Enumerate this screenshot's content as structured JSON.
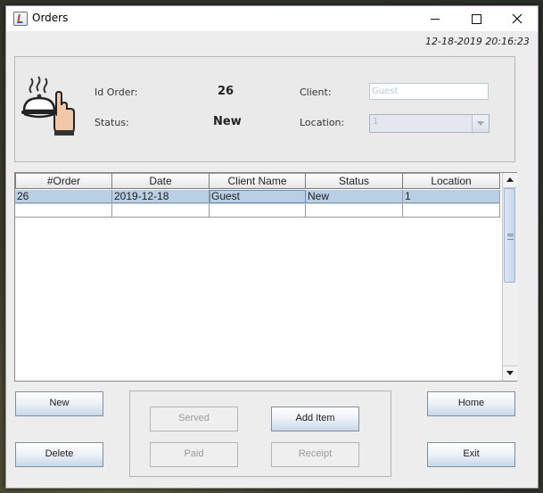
{
  "window": {
    "title": "Orders",
    "timestamp": "12-18-2019 20:16:23"
  },
  "icons": {
    "app": "java-coffee-icon",
    "serve": "serving-cloche-hand-icon"
  },
  "order_info": {
    "id_label": "Id Order:",
    "id_value": "26",
    "status_label": "Status:",
    "status_value": "New",
    "client_label": "Client:",
    "client_value": "Guest",
    "location_label": "Location:",
    "location_value": "1"
  },
  "table": {
    "columns": [
      "#Order",
      "Date",
      "Client Name",
      "Status",
      "Location"
    ],
    "rows": [
      [
        "26",
        "2019-12-18",
        "Guest",
        "New",
        "1"
      ],
      [
        "",
        "",
        "",
        "",
        ""
      ]
    ],
    "selected_row": 0
  },
  "buttons": {
    "new": "New",
    "delete": "Delete",
    "served": "Served",
    "add_item": "Add Item",
    "paid": "Paid",
    "receipt": "Receipt",
    "home": "Home",
    "exit": "Exit"
  },
  "colors": {
    "selection": "#b8cfe5",
    "button_edge": "#7d8ea5",
    "disabled_text": "#9a9a9a"
  }
}
